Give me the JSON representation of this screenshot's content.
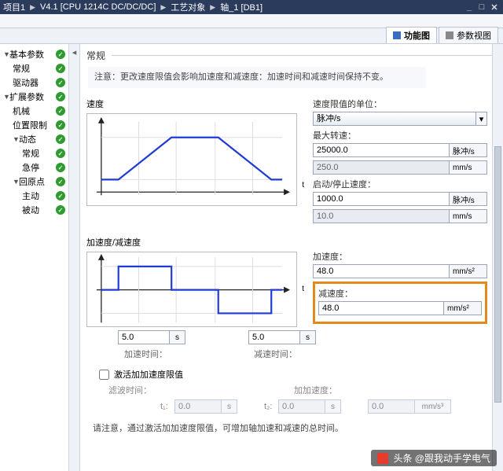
{
  "breadcrumb": [
    "项目1",
    "V4.1 [CPU 1214C DC/DC/DC]",
    "工艺对象",
    "轴_1 [DB1]"
  ],
  "tabs": {
    "func": "功能图",
    "param": "参数视图"
  },
  "tree": [
    {
      "depth": 1,
      "label": "基本参数",
      "expand": true
    },
    {
      "depth": 2,
      "label": "常规"
    },
    {
      "depth": 2,
      "label": "驱动器"
    },
    {
      "depth": 1,
      "label": "扩展参数",
      "expand": true
    },
    {
      "depth": 2,
      "label": "机械"
    },
    {
      "depth": 2,
      "label": "位置限制"
    },
    {
      "depth": 2,
      "label": "动态",
      "expand": true
    },
    {
      "depth": 3,
      "label": "常规"
    },
    {
      "depth": 3,
      "label": "急停"
    },
    {
      "depth": 2,
      "label": "回原点",
      "expand": true
    },
    {
      "depth": 3,
      "label": "主动"
    },
    {
      "depth": 3,
      "label": "被动"
    }
  ],
  "section": {
    "title": "常规"
  },
  "note": "注意：更改速度限值会影响加速度和减速度：加速时间和减速时间保持不变。",
  "speed": {
    "graph_label": "速度",
    "unit_label": "速度限值的单位：",
    "unit_value": "脉冲/s",
    "max_label": "最大转速：",
    "max_value": "25000.0",
    "max_unit": "脉冲/s",
    "max_mm_value": "250.0",
    "max_mm_unit": "mm/s",
    "startstop_label": "启动/停止速度：",
    "ss_value": "1000.0",
    "ss_unit": "脉冲/s",
    "ss_mm_value": "10.0",
    "ss_mm_unit": "mm/s",
    "axis_t": "t"
  },
  "accel": {
    "graph_label": "加速度/减速度",
    "acc_label": "加速度：",
    "acc_value": "48.0",
    "acc_unit": "mm/s²",
    "dec_label": "减速度：",
    "dec_value": "48.0",
    "dec_unit": "mm/s²",
    "axis_t": "t"
  },
  "times": {
    "t1": "5.0",
    "t2": "5.0",
    "unit": "s",
    "lbl1": "加速时间：",
    "lbl2": "减速时间："
  },
  "jerk": {
    "check_label": "激活加加速度限值",
    "filter_label": "滤波时间：",
    "t1_lbl": "t₁:",
    "t1_val": "0.0",
    "t2_lbl": "t₂:",
    "t2_val": "0.0",
    "s_unit": "s",
    "j_label": "加加速度：",
    "j_val": "0.0",
    "j_unit": "mm/s³"
  },
  "bottom_note": "请注意，通过激活加加速度限值，可增加轴加速和减速的总时间。",
  "watermark": "头条 @跟我动手学电气"
}
